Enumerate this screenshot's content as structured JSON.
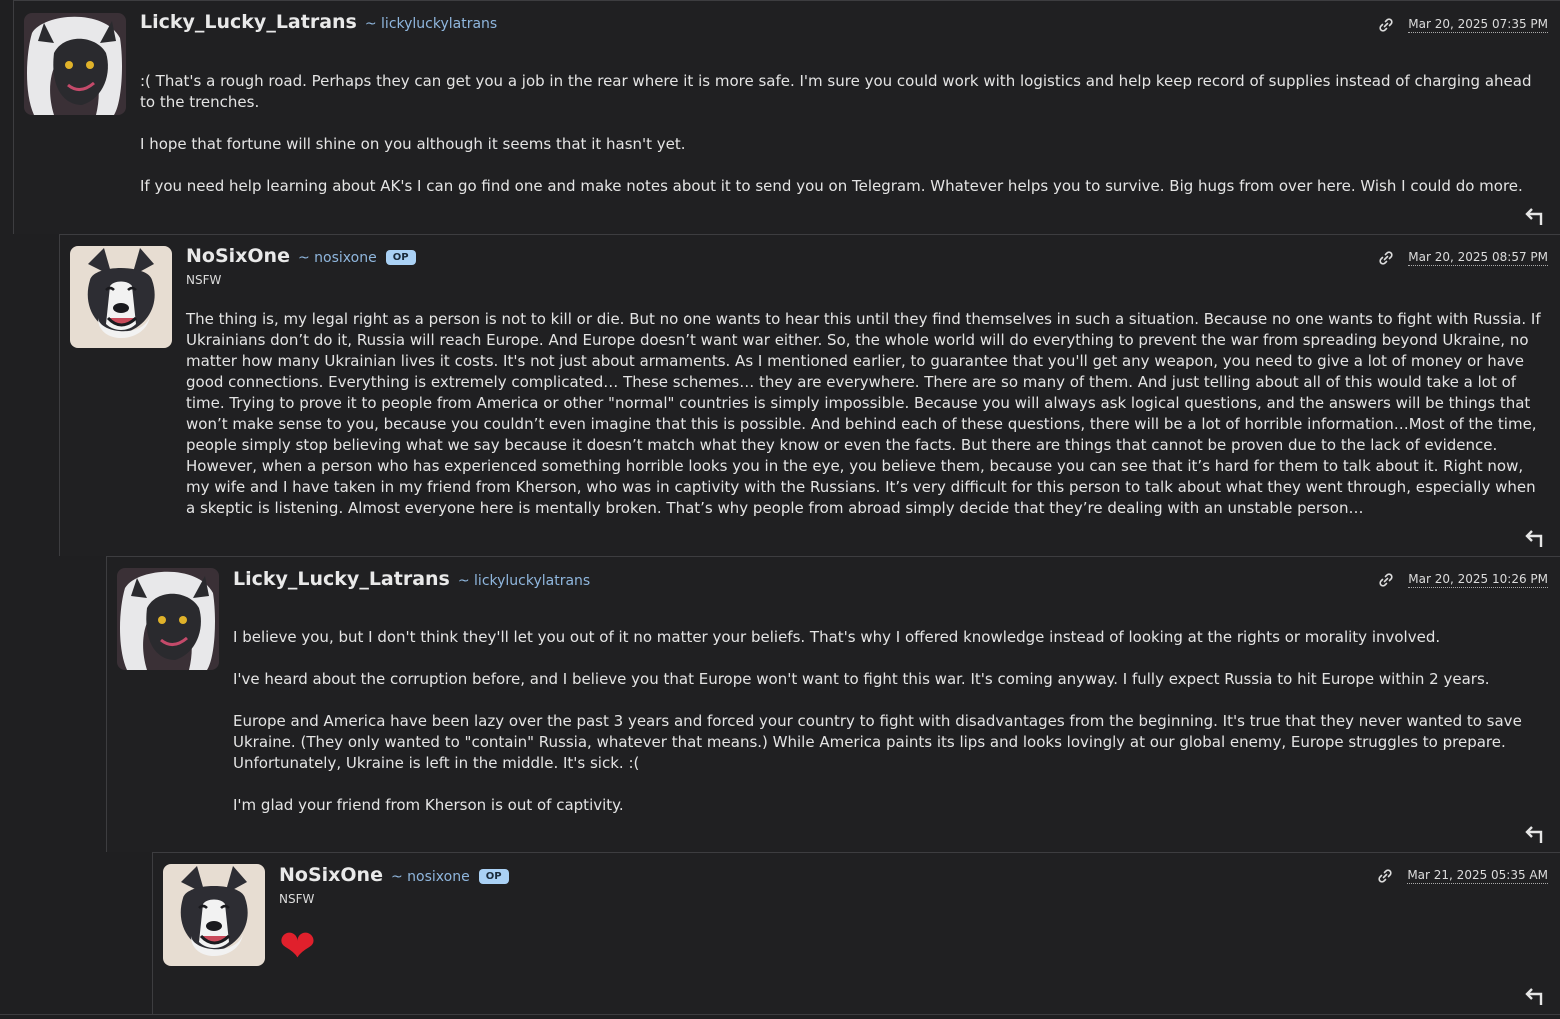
{
  "comments": [
    {
      "username": "Licky_Lucky_Latrans",
      "handle": "~ lickyluckylatrans",
      "timestamp": "Mar 20, 2025 07:35 PM",
      "paragraphs": [
        ":( That's a rough road. Perhaps they can get you a job in the rear where it is more safe. I'm sure you could work with logistics and help keep record of supplies instead of charging ahead to the trenches.",
        "I hope that fortune will shine on you although it seems that it hasn't yet.",
        "If you need help learning about AK's I can go find one and make notes about it to send you on Telegram. Whatever helps you to survive. Big hugs from over here. Wish I could do more."
      ]
    },
    {
      "username": "NoSixOne",
      "handle": "~ nosixone",
      "badge": "OP",
      "rating": "NSFW",
      "timestamp": "Mar 20, 2025 08:57 PM",
      "paragraphs": [
        "The thing is, my legal right as a person is not to kill or die. But no one wants to hear this until they find themselves in such a situation. Because no one wants to fight with Russia. If Ukrainians don’t do it, Russia will reach Europe. And Europe doesn’t want war either. So, the whole world will do everything to prevent the war from spreading beyond Ukraine, no matter how many Ukrainian lives it costs. It's not just about armaments. As I mentioned earlier, to guarantee that you'll get any weapon, you need to give a lot of money or have good connections. Everything is extremely complicated… These schemes… they are everywhere. There are so many of them. And just telling about all of this would take a lot of time. Trying to prove it to people from America or other \"normal\" countries is simply impossible. Because you will always ask logical questions, and the answers will be things that won’t make sense to you, because you couldn’t even imagine that this is possible. And behind each of these questions, there will be a lot of horrible information…Most of the time, people simply stop believing what we say because it doesn’t match what they know or even the facts. But there are things that cannot be proven due to the lack of evidence. However, when a person who has experienced something horrible looks you in the eye, you believe them, because you can see that it’s hard for them to talk about it. Right now, my wife and I have taken in my friend from Kherson, who was in captivity with the Russians. It’s very difficult for this person to talk about what they went through, especially when a skeptic is listening. Almost everyone here is mentally broken. That’s why people from abroad simply decide that they’re dealing with an unstable person…"
      ]
    },
    {
      "username": "Licky_Lucky_Latrans",
      "handle": "~ lickyluckylatrans",
      "timestamp": "Mar 20, 2025 10:26 PM",
      "paragraphs": [
        "I believe you, but I don't think they'll let you out of it no matter your beliefs. That's why I offered knowledge instead of looking at the rights or morality involved.",
        "I've heard about the corruption before, and I believe you that Europe won't want to fight this war. It's coming anyway. I fully expect Russia to hit Europe within 2 years.",
        "Europe and America have been lazy over the past 3 years and forced your country to fight with disadvantages from the beginning. It's true that they never wanted to save Ukraine. (They only wanted to \"contain\" Russia, whatever that means.) While America paints its lips and looks lovingly at our global enemy, Europe struggles to prepare. Unfortunately, Ukraine is left in the middle. It's sick. :(",
        "I'm glad your friend from Kherson is out of captivity."
      ]
    },
    {
      "username": "NoSixOne",
      "handle": "~ nosixone",
      "badge": "OP",
      "rating": "NSFW",
      "timestamp": "Mar 21, 2025 05:35 AM",
      "body_emoji": "❤"
    }
  ],
  "icons": {
    "permalink": "link-icon",
    "reply": "reply-icon"
  },
  "colors": {
    "background": "#1f1f21",
    "handle": "#8fb6dd",
    "op_badge": "#aad1f5",
    "border": "#3d3d40"
  }
}
